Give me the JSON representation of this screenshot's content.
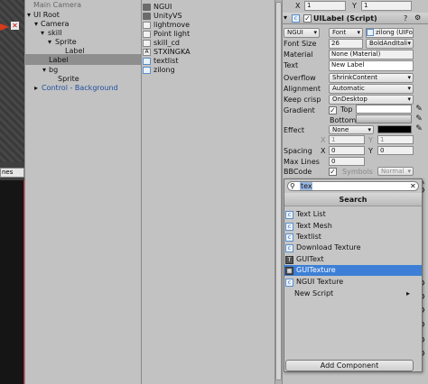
{
  "scene": {
    "field_text": "nes"
  },
  "hierarchy": {
    "items": [
      {
        "label": "Main Camera"
      },
      {
        "label": "UI Root"
      },
      {
        "label": "Camera"
      },
      {
        "label": "skill"
      },
      {
        "label": "Sprite"
      },
      {
        "label": "Label"
      },
      {
        "label": "Label"
      },
      {
        "label": "bg"
      },
      {
        "label": "Sprite"
      },
      {
        "label": "Control - Background"
      }
    ]
  },
  "project": {
    "items": [
      {
        "label": "NGUI",
        "icon": "folder-icon"
      },
      {
        "label": "UnityVS",
        "icon": "folder-icon"
      },
      {
        "label": "lightmove",
        "icon": "file-icon"
      },
      {
        "label": "Point light",
        "icon": "file-icon"
      },
      {
        "label": "skill_cd",
        "icon": "file-icon"
      },
      {
        "label": "STXINGKA",
        "icon": "font-icon"
      },
      {
        "label": "textlist",
        "icon": "script-icon"
      },
      {
        "label": "zilong",
        "icon": "script-icon"
      }
    ]
  },
  "inspector": {
    "transform_x": "1",
    "transform_y": "1",
    "component_title": "UILabel (Script)",
    "font_type": "NGUI",
    "font_label": "Font",
    "font_value": "zilong (UIFo",
    "font_size_label": "Font Size",
    "font_size": "26",
    "bold_italic": "BoldAndItali",
    "material_label": "Material",
    "material_value": "None (Material)",
    "text_label": "Text",
    "text_value": "New Label",
    "overflow_label": "Overflow",
    "overflow_value": "ShrinkContent",
    "alignment_label": "Alignment",
    "alignment_value": "Automatic",
    "keepcrisp_label": "Keep crisp",
    "keepcrisp_value": "OnDesktop",
    "gradient_label": "Gradient",
    "top_label": "Top",
    "bottom_label": "Bottom",
    "effect_label": "Effect",
    "effect_value": "None",
    "effect_x_label": "X",
    "effect_x": "1",
    "effect_y_label": "Y",
    "effect_y": "1",
    "spacing_label": "Spacing",
    "spacing_x_label": "X",
    "spacing_x": "0",
    "spacing_y_label": "Y",
    "spacing_y": "0",
    "maxlines_label": "Max Lines",
    "maxlines_value": "0",
    "bbcode_label": "BBCode",
    "symbols_label": "Symbols",
    "symbols_value": "Normal"
  },
  "add_component": {
    "search_value": "tex",
    "header": "Search",
    "items": [
      {
        "label": "Text List",
        "icon": "script-icon"
      },
      {
        "label": "Text Mesh",
        "icon": "script-icon"
      },
      {
        "label": "Textlist",
        "icon": "script-icon"
      },
      {
        "label": "Download Texture",
        "icon": "script-icon"
      },
      {
        "label": "GUIText",
        "icon": "guitext-icon"
      },
      {
        "label": "GUITexture",
        "icon": "guitexture-icon"
      },
      {
        "label": "NGUI Texture",
        "icon": "script-icon"
      },
      {
        "label": "New Script",
        "icon": ""
      }
    ],
    "button_label": "Add Component"
  }
}
